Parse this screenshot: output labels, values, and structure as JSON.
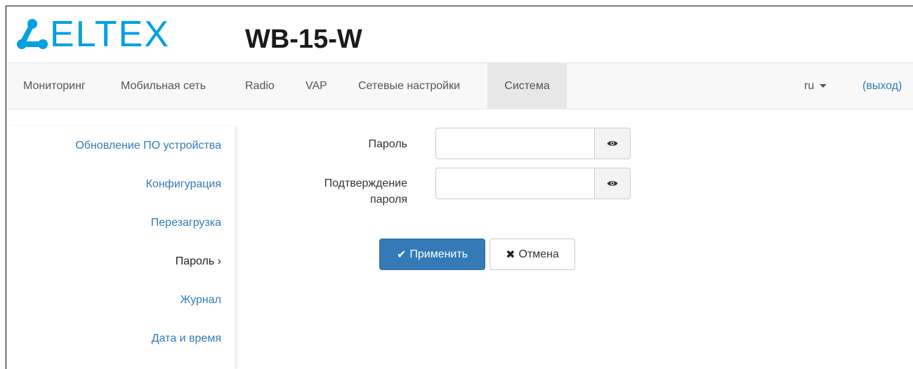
{
  "brand": {
    "logo_text": "ELTEX",
    "model": "WB-15-W",
    "color": "#00a0e3"
  },
  "navbar": {
    "items": [
      {
        "label": "Мониторинг"
      },
      {
        "label": "Мобильная сеть"
      },
      {
        "label": "Radio"
      },
      {
        "label": "VAP"
      },
      {
        "label": "Сетевые настройки"
      },
      {
        "label": "Система"
      }
    ],
    "active": "Система",
    "lang": "ru",
    "logout": "(выход)"
  },
  "sidebar": {
    "items": [
      {
        "label": "Обновление ПО устройства"
      },
      {
        "label": "Конфигурация"
      },
      {
        "label": "Перезагрузка"
      },
      {
        "label": "Пароль ›"
      },
      {
        "label": "Журнал"
      },
      {
        "label": "Дата и время"
      }
    ],
    "active": "Пароль ›"
  },
  "form": {
    "password_label": "Пароль",
    "password_value": "",
    "confirm_label_line1": "Подтверждение",
    "confirm_label_line2": "пароля",
    "confirm_value": ""
  },
  "actions": {
    "apply": "Применить",
    "cancel": "Отмена"
  },
  "colors": {
    "primary": "#337ab7",
    "link": "#337ab7",
    "nav_bg": "#f8f8f8",
    "nav_active_bg": "#e7e7e7"
  }
}
